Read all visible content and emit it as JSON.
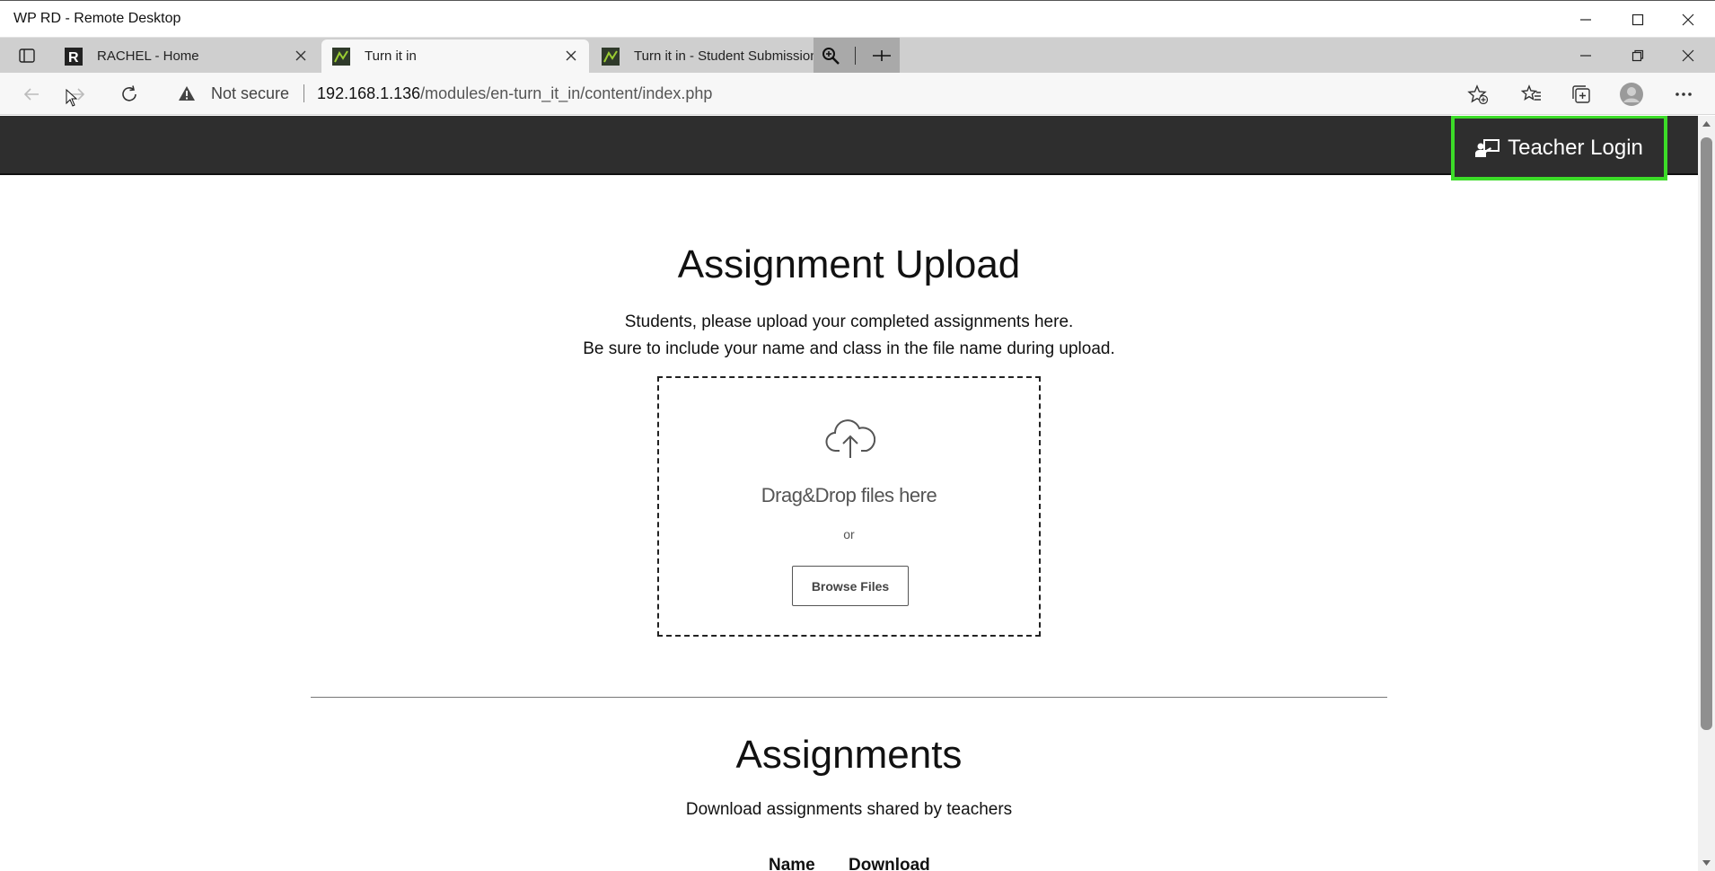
{
  "window": {
    "title": "WP RD - Remote Desktop"
  },
  "tabs": [
    {
      "label": "RACHEL - Home",
      "favicon": "rachel-logo-icon"
    },
    {
      "label": "Turn it in",
      "favicon": "turn-it-in-icon",
      "active": true
    },
    {
      "label": "Turn it in - Student Submissions",
      "favicon": "turn-it-in-icon"
    }
  ],
  "address_bar": {
    "security_label": "Not secure",
    "url_host": "192.168.1.136",
    "url_path": "/modules/en-turn_it_in/content/index.php"
  },
  "header": {
    "teacher_login_label": "Teacher Login",
    "highlight_color": "#3cdc28"
  },
  "upload": {
    "title": "Assignment Upload",
    "line1": "Students, please upload your completed assignments here.",
    "line2": "Be sure to include your name and class in the file name during upload.",
    "drop_text": "Drag&Drop files here",
    "or_text": "or",
    "browse_label": "Browse Files"
  },
  "assignments": {
    "title": "Assignments",
    "subtitle": "Download assignments shared by teachers",
    "columns": [
      "Name",
      "Download"
    ]
  }
}
